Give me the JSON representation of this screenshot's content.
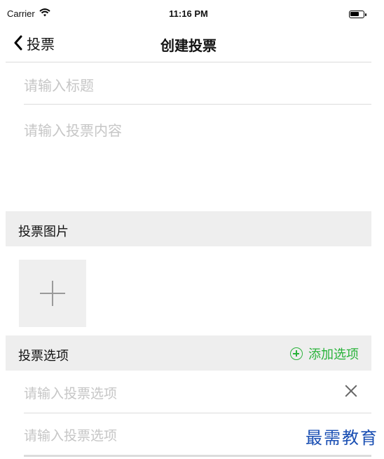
{
  "status_bar": {
    "carrier": "Carrier",
    "time": "11:16 PM"
  },
  "nav": {
    "back_label": "投票",
    "title": "创建投票"
  },
  "form": {
    "title_placeholder": "请输入标题",
    "content_placeholder": "请输入投票内容"
  },
  "image_section": {
    "label": "投票图片"
  },
  "options_section": {
    "label": "投票选项",
    "add_label": "添加选项",
    "items": [
      {
        "placeholder": "请输入投票选项"
      },
      {
        "placeholder": "请输入投票选项"
      }
    ]
  },
  "watermark": "最需教育",
  "colors": {
    "accent": "#29b33a",
    "section_bg": "#eeeeee",
    "placeholder": "#c6c6c6"
  }
}
